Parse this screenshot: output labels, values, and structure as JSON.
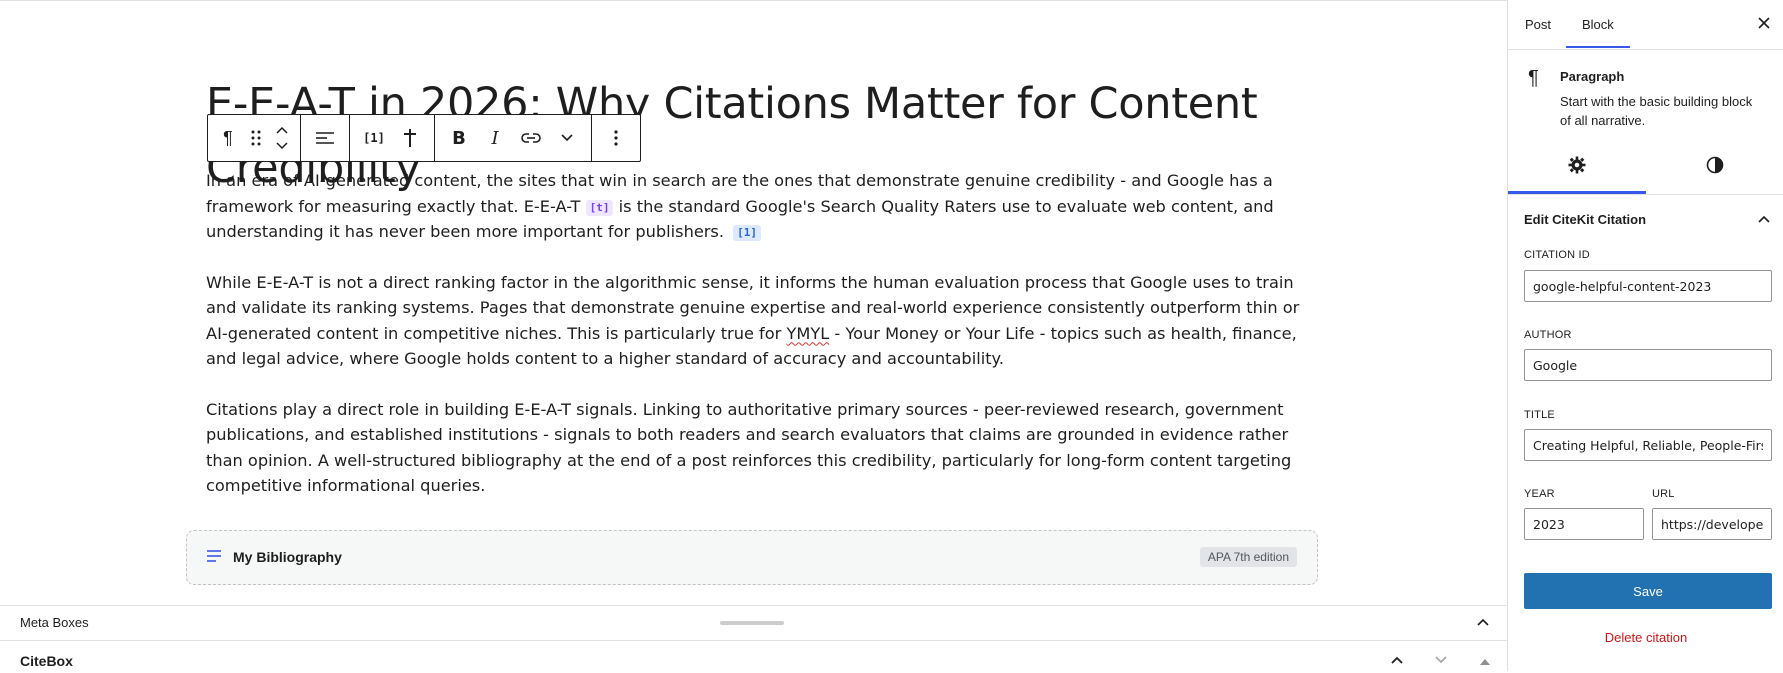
{
  "editor": {
    "title_line1": "E-E-A-T in 2026: Why Citations Matter for Content",
    "title_line2": "Credibility",
    "toolbar": {
      "citation_label": "[1]"
    },
    "paragraphs": [
      {
        "part1": "In an era of AI-generated content, the sites that win in search are the ones that demonstrate genuine credibility - and Google has a framework for measuring exactly that. E-E-A-T",
        "mark_t": "[t]",
        "part2": " is the standard Google's Search Quality Raters use to evaluate web content, and understanding it has never been more important for publishers.",
        "mark_n": "[1]"
      },
      {
        "part1": "While E-E-A-T is not a direct ranking factor in the algorithmic sense, it informs the human evaluation process that Google uses to train and validate its ranking systems. Pages that demonstrate genuine expertise and real-world experience consistently outperform thin or AI-generated content in competitive niches. This is particularly true for ",
        "squiggle": "YMYL",
        "part2": " - Your Money or Your Life - topics such as health, finance, and legal advice, where Google holds content to a higher standard of accuracy and accountability."
      },
      {
        "text": "Citations play a direct role in building E-E-A-T signals. Linking to authoritative primary sources - peer-reviewed research, government publications, and established institutions - signals to both readers and search evaluators that claims are grounded in evidence rather than opinion. A well-structured bibliography at the end of a post reinforces this credibility, particularly for long-form content targeting competitive informational queries."
      }
    ],
    "bibliography": {
      "title": "My Bibliography",
      "style_badge": "APA 7th edition"
    }
  },
  "meta": {
    "title": "Meta Boxes",
    "citebox_title": "CiteBox"
  },
  "sidebar": {
    "tabs": [
      "Post",
      "Block"
    ],
    "block_name": "Paragraph",
    "block_desc": "Start with the basic building block of all narrative.",
    "panel_title": "Edit CiteKit Citation",
    "fields": {
      "citation_id_label": "CITATION ID",
      "citation_id_value": "google-helpful-content-2023",
      "author_label": "AUTHOR",
      "author_value": "Google",
      "title_label": "TITLE",
      "title_value": "Creating Helpful, Reliable, People-First Content",
      "year_label": "YEAR",
      "year_value": "2023",
      "url_label": "URL",
      "url_value": "https://developers.google.com/search/docs/fundamentals/creating-helpful-content"
    },
    "save_label": "Save",
    "delete_label": "Delete citation"
  },
  "colors": {
    "accent": "#3858e9",
    "save": "#2271b1",
    "danger": "#cc1818"
  }
}
